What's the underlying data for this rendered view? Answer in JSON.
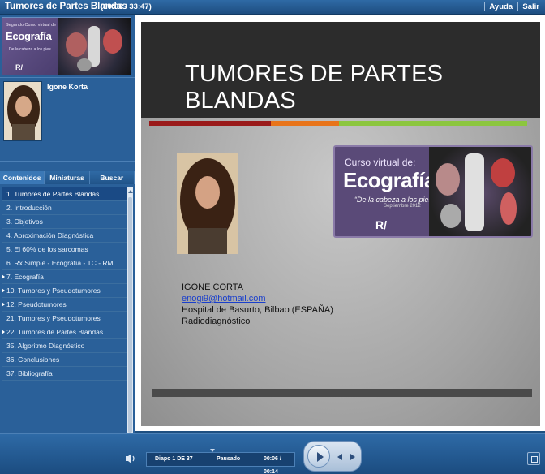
{
  "window": {
    "title": "Tumores de Partes Blandas",
    "elapsed": "(00:06 / 33:47)",
    "nav": [
      "Ayuda",
      "Salir"
    ]
  },
  "sidebar": {
    "logo": {
      "line1": "Segundo Curso virtual de",
      "line2": "Ecografía",
      "line3": "De la cabeza a los pies",
      "brand": "R/"
    },
    "presenter_name": "Igone Korta",
    "tabs": [
      "Contenidos",
      "Miniaturas",
      "Buscar"
    ],
    "active_tab": "Contenidos",
    "toc": [
      {
        "label": "1. Tumores de Partes Blandas",
        "active": true,
        "expandable": false
      },
      {
        "label": "2. Introducción",
        "active": false,
        "expandable": false
      },
      {
        "label": "3. Objetivos",
        "active": false,
        "expandable": false
      },
      {
        "label": "4. Aproximación Diagnóstica",
        "active": false,
        "expandable": false
      },
      {
        "label": "5. El 60% de los sarcomas",
        "active": false,
        "expandable": false
      },
      {
        "label": "6. Rx Simple - Ecografía - TC - RM",
        "active": false,
        "expandable": false
      },
      {
        "label": "7. Ecografía",
        "active": false,
        "expandable": true
      },
      {
        "label": "10. Tumores y Pseudotumores",
        "active": false,
        "expandable": true
      },
      {
        "label": "12. Pseudotumores",
        "active": false,
        "expandable": true
      },
      {
        "label": "21. Tumores y Pseudotumores",
        "active": false,
        "expandable": false
      },
      {
        "label": "22. Tumores de Partes Blandas",
        "active": false,
        "expandable": true
      },
      {
        "label": "35. Algoritmo Diagnóstico",
        "active": false,
        "expandable": false
      },
      {
        "label": "36. Conclusiones",
        "active": false,
        "expandable": false
      },
      {
        "label": "37. Bibliografía",
        "active": false,
        "expandable": false
      }
    ]
  },
  "slide": {
    "title": "TUMORES DE PARTES BLANDAS",
    "stripe_colors": [
      "#9a1a1a",
      "#e8741a",
      "#8cc63f"
    ],
    "logo": {
      "line1": "Curso virtual de:",
      "line2": "Ecografía",
      "line3": "“De la cabeza a los pies”",
      "line4": "Septiembre 2012",
      "brand": "R/"
    },
    "author": {
      "name": "IGONE CORTA",
      "email": "enogi9@hotmail.com",
      "hospital": "Hospital de Basurto, Bilbao (ESPAÑA)",
      "department": "Radiodiagnóstico"
    }
  },
  "player": {
    "slide_counter": "Diapo 1 DE 37",
    "state": "Pausado",
    "time": "00:06 / 00:14"
  }
}
